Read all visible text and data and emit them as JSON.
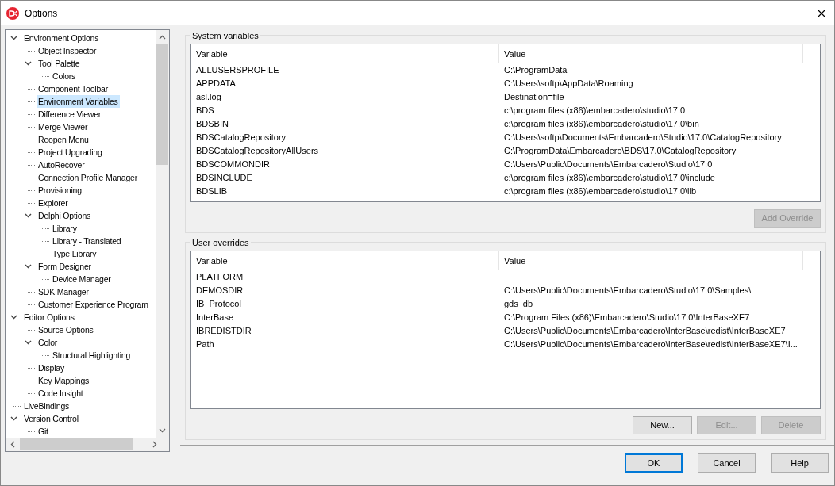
{
  "window": {
    "title": "Options"
  },
  "tree": [
    {
      "label": "Environment Options",
      "expanded": true,
      "selected": false,
      "children": [
        {
          "label": "Object Inspector",
          "selected": false
        },
        {
          "label": "Tool Palette",
          "expanded": true,
          "selected": false,
          "children": [
            {
              "label": "Colors",
              "selected": false
            }
          ]
        },
        {
          "label": "Component Toolbar",
          "selected": false
        },
        {
          "label": "Environment Variables",
          "selected": true
        },
        {
          "label": "Difference Viewer",
          "selected": false
        },
        {
          "label": "Merge Viewer",
          "selected": false
        },
        {
          "label": "Reopen Menu",
          "selected": false
        },
        {
          "label": "Project Upgrading",
          "selected": false
        },
        {
          "label": "AutoRecover",
          "selected": false
        },
        {
          "label": "Connection Profile Manager",
          "selected": false
        },
        {
          "label": "Provisioning",
          "selected": false
        },
        {
          "label": "Explorer",
          "selected": false
        },
        {
          "label": "Delphi Options",
          "expanded": true,
          "selected": false,
          "children": [
            {
              "label": "Library",
              "selected": false
            },
            {
              "label": "Library - Translated",
              "selected": false
            },
            {
              "label": "Type Library",
              "selected": false
            }
          ]
        },
        {
          "label": "Form Designer",
          "expanded": true,
          "selected": false,
          "children": [
            {
              "label": "Device Manager",
              "selected": false
            }
          ]
        },
        {
          "label": "SDK Manager",
          "selected": false
        },
        {
          "label": "Customer Experience Program",
          "selected": false
        }
      ]
    },
    {
      "label": "Editor Options",
      "expanded": true,
      "selected": false,
      "children": [
        {
          "label": "Source Options",
          "selected": false
        },
        {
          "label": "Color",
          "expanded": true,
          "selected": false,
          "children": [
            {
              "label": "Structural Highlighting",
              "selected": false
            }
          ]
        },
        {
          "label": "Display",
          "selected": false
        },
        {
          "label": "Key Mappings",
          "selected": false
        },
        {
          "label": "Code Insight",
          "selected": false
        }
      ]
    },
    {
      "label": "LiveBindings",
      "selected": false
    },
    {
      "label": "Version Control",
      "expanded": true,
      "selected": false,
      "children": [
        {
          "label": "Git",
          "selected": false
        }
      ]
    }
  ],
  "system_variables": {
    "title": "System variables",
    "columns": [
      "Variable",
      "Value"
    ],
    "rows": [
      [
        "ALLUSERSPROFILE",
        "C:\\ProgramData"
      ],
      [
        "APPDATA",
        "C:\\Users\\softp\\AppData\\Roaming"
      ],
      [
        "asl.log",
        "Destination=file"
      ],
      [
        "BDS",
        "c:\\program files (x86)\\embarcadero\\studio\\17.0"
      ],
      [
        "BDSBIN",
        "c:\\program files (x86)\\embarcadero\\studio\\17.0\\bin"
      ],
      [
        "BDSCatalogRepository",
        "C:\\Users\\softp\\Documents\\Embarcadero\\Studio\\17.0\\CatalogRepository"
      ],
      [
        "BDSCatalogRepositoryAllUsers",
        "C:\\ProgramData\\Embarcadero\\BDS\\17.0\\CatalogRepository"
      ],
      [
        "BDSCOMMONDIR",
        "C:\\Users\\Public\\Documents\\Embarcadero\\Studio\\17.0"
      ],
      [
        "BDSINCLUDE",
        "c:\\program files (x86)\\embarcadero\\studio\\17.0\\include"
      ],
      [
        "BDSLIB",
        "c:\\program files (x86)\\embarcadero\\studio\\17.0\\lib"
      ]
    ],
    "buttons": [
      {
        "label": "Add Override",
        "disabled": true
      }
    ]
  },
  "user_overrides": {
    "title": "User overrides",
    "columns": [
      "Variable",
      "Value"
    ],
    "rows": [
      [
        "PLATFORM",
        ""
      ],
      [
        "DEMOSDIR",
        "C:\\Users\\Public\\Documents\\Embarcadero\\Studio\\17.0\\Samples\\"
      ],
      [
        "IB_Protocol",
        "gds_db"
      ],
      [
        "InterBase",
        "C:\\Program Files (x86)\\Embarcadero\\Studio\\17.0\\InterBaseXE7"
      ],
      [
        "IBREDISTDIR",
        "C:\\Users\\Public\\Documents\\Embarcadero\\InterBase\\redist\\InterBaseXE7"
      ],
      [
        "Path",
        "C:\\Users\\Public\\Documents\\Embarcadero\\InterBase\\redist\\InterBaseXE7\\I..."
      ]
    ],
    "buttons": [
      {
        "label": "New...",
        "disabled": false
      },
      {
        "label": "Edit...",
        "disabled": true
      },
      {
        "label": "Delete",
        "disabled": true
      }
    ]
  },
  "dialog_buttons": [
    {
      "label": "OK",
      "default": true
    },
    {
      "label": "Cancel",
      "default": false
    },
    {
      "label": "Help",
      "default": false
    }
  ]
}
